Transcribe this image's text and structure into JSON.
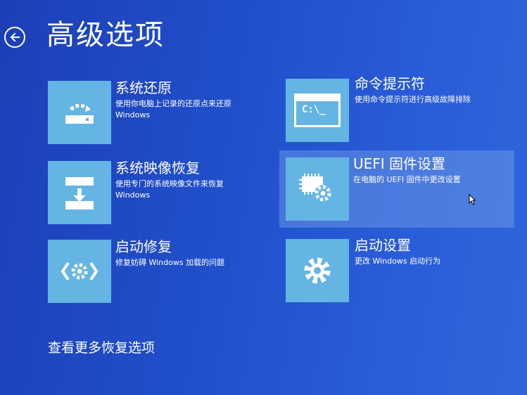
{
  "header": {
    "title": "高级选项",
    "back_icon": "back-arrow-icon"
  },
  "options": [
    {
      "title": "系统还原",
      "desc": "使用你电脑上记录的还原点来还原 Windows",
      "icon": "system-restore-icon"
    },
    {
      "title": "系统映像恢复",
      "desc": "使用专门的系统映像文件来恢复 Windows",
      "icon": "image-recovery-icon"
    },
    {
      "title": "启动修复",
      "desc": "修复妨碍 Windows 加载的问题",
      "icon": "startup-repair-icon"
    },
    {
      "title": "命令提示符",
      "desc": "使用命令提示符进行高级故障排除",
      "icon": "command-prompt-icon",
      "icon_text": "C:\\_"
    },
    {
      "title": "UEFI 固件设置",
      "desc": "在电脑的 UEFI 固件中更改设置",
      "icon": "firmware-settings-icon",
      "selected": true
    },
    {
      "title": "启动设置",
      "desc": "更改 Windows 启动行为",
      "icon": "startup-settings-icon"
    }
  ],
  "footer": {
    "more_link": "查看更多恢复选项"
  },
  "colors": {
    "background": "#2150cc",
    "tile": "#64b4e4",
    "selected_highlight": "#8cb4f0",
    "text": "#ffffff"
  }
}
